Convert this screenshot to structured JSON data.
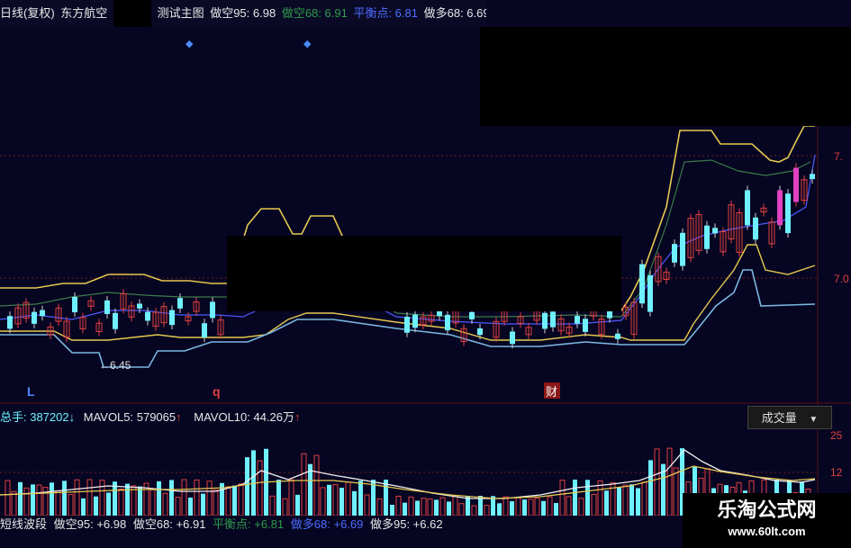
{
  "main_legend": {
    "period": "日线(复权)",
    "stock": "东方航空",
    "indicator": "测试主图",
    "items": [
      {
        "label": "做空95: 6.98",
        "color": "#e8e8e8"
      },
      {
        "label": "做空68: 6.91",
        "color": "#2e9a4a"
      },
      {
        "label": "平衡点: 6.81",
        "color": "#4d6cff"
      },
      {
        "label": "做多68: 6.69",
        "color": "#e8e8e8"
      },
      {
        "label": "做多",
        "color": "#4d6cff"
      }
    ]
  },
  "markers": {
    "low_label": "←6.45",
    "l_label": "L",
    "q_label": "q",
    "cai_label": "财"
  },
  "price_axis": {
    "labels": [
      "7.",
      "7.0"
    ]
  },
  "volume_legend": {
    "total": "总手: 387202",
    "total_arrow": "↓",
    "mavol5": "MAVOL5: 579065",
    "mavol5_arrow": "↑",
    "mavol10": "MAVOL10: 44.26万",
    "mavol10_arrow": "↑",
    "select_value": "成交量"
  },
  "volume_axis": {
    "labels": [
      "25",
      "12"
    ]
  },
  "bottom_legend": {
    "name": "短线波段",
    "items": [
      {
        "label": "做空95: +6.98",
        "color": "#e8e8e8"
      },
      {
        "label": "做空68: +6.91",
        "color": "#e8e8e8"
      },
      {
        "label": "平衡点: +6.81",
        "color": "#2e9a4a"
      },
      {
        "label": "做多68: +6.69",
        "color": "#4d6cff"
      },
      {
        "label": "做多95: +6.62",
        "color": "#e8e8e8"
      }
    ]
  },
  "watermark": {
    "title": "乐淘公式网",
    "url": "www.60lt.com"
  },
  "colors": {
    "background": "#060622",
    "up": "#e04040",
    "down": "#6ff0ff",
    "grid": "#7a1a1a",
    "band_upper": "#e6c850",
    "band_lower": "#7ab6e0"
  }
}
